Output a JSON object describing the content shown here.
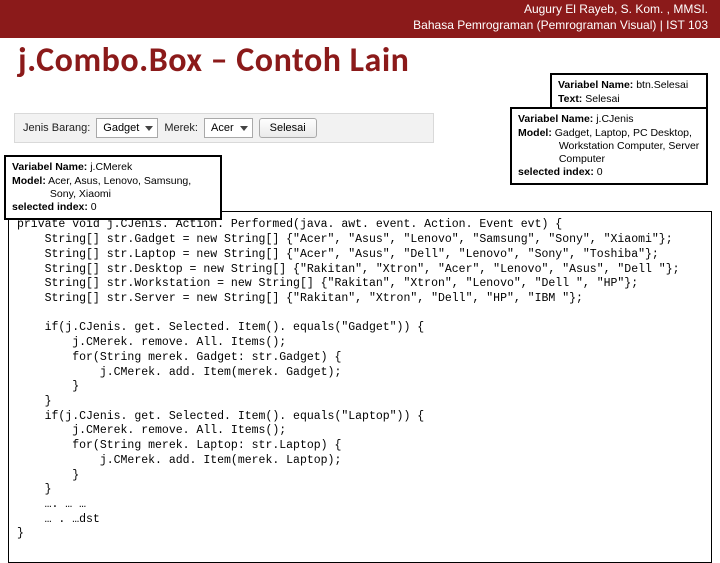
{
  "header": {
    "line1": "Augury El Rayeb, S. Kom. , MMSI.",
    "line2": "Bahasa Pemrograman (Pemrograman Visual) | IST 103"
  },
  "title": "j.Combo.Box – Contoh Lain",
  "strip": {
    "label_jenis": "Jenis Barang:",
    "value_jenis": "Gadget",
    "label_merek": "Merek:",
    "value_merek": "Acer",
    "button_selesai": "Selesai"
  },
  "callouts": {
    "selesai": "Variabel Name: btn.Selesai\nText: Selesai",
    "jenis": "Variabel Name: j.CJenis\nModel: Gadget, Laptop, PC Desktop,\n              Workstation Computer, Server\n              Computer\nselected index: 0",
    "merek": "Variabel Name: j.CMerek\nModel: Acer, Asus, Lenovo, Samsung,\n             Sony, Xiaomi\nselected index: 0"
  },
  "code": "private void j.CJenis. Action. Performed(java. awt. event. Action. Event evt) {\n    String[] str.Gadget = new String[] {\"Acer\", \"Asus\", \"Lenovo\", \"Samsung\", \"Sony\", \"Xiaomi\"};\n    String[] str.Laptop = new String[] {\"Acer\", \"Asus\", \"Dell\", \"Lenovo\", \"Sony\", \"Toshiba\"};\n    String[] str.Desktop = new String[] {\"Rakitan\", \"Xtron\", \"Acer\", \"Lenovo\", \"Asus\", \"Dell \"};\n    String[] str.Workstation = new String[] {\"Rakitan\", \"Xtron\", \"Lenovo\", \"Dell \", \"HP\"};\n    String[] str.Server = new String[] {\"Rakitan\", \"Xtron\", \"Dell\", \"HP\", \"IBM \"};\n\n    if(j.CJenis. get. Selected. Item(). equals(\"Gadget\")) {\n        j.CMerek. remove. All. Items();\n        for(String merek. Gadget: str.Gadget) {\n            j.CMerek. add. Item(merek. Gadget);\n        }\n    }\n    if(j.CJenis. get. Selected. Item(). equals(\"Laptop\")) {\n        j.CMerek. remove. All. Items();\n        for(String merek. Laptop: str.Laptop) {\n            j.CMerek. add. Item(merek. Laptop);\n        }\n    }\n    …. … …\n    … . …dst\n}"
}
